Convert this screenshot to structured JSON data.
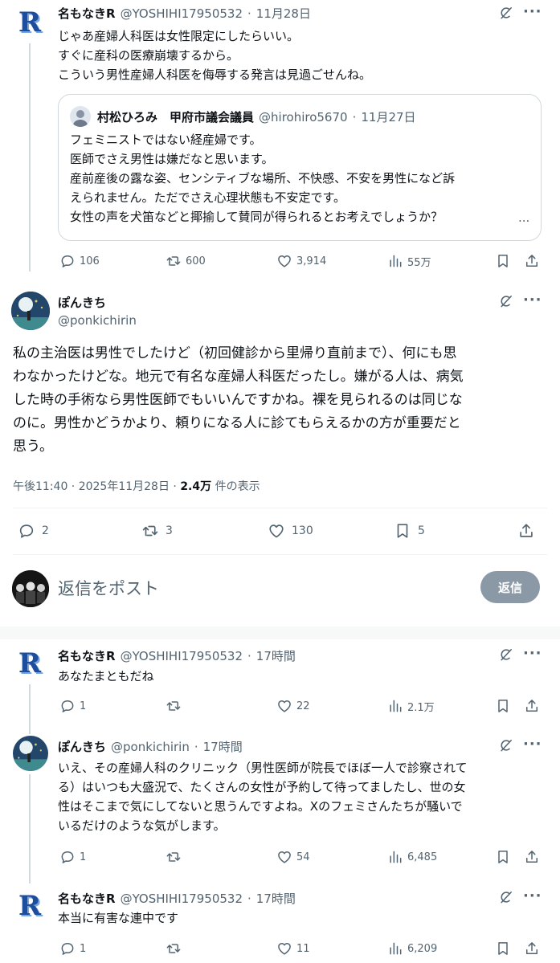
{
  "post1": {
    "name": "名もなきR",
    "handle": "@YOSHIHI17950532",
    "date": "11月28日",
    "lines": [
      "じゃあ産婦人科医は女性限定にしたらいい。",
      "すぐに産科の医療崩壊するから。",
      "こういう男性産婦人科医を侮辱する発言は見過ごせんね。"
    ],
    "quote": {
      "name": "村松ひろみ　甲府市議会議員",
      "handle": "@hirohiro5670",
      "date": "11月27日",
      "lines": [
        "フェミニストではない経産婦です。",
        "医師でさえ男性は嫌だなと思います。",
        "産前産後の露な姿、センシティブな場所、不快感、不安を男性になど訴",
        "えられません。ただでさえ心理状態も不安定です。",
        "女性の声を犬笛などと揶揄して賛同が得られるとお考えでしょうか？"
      ],
      "ellipsis": "..."
    },
    "replies": "106",
    "reposts": "600",
    "likes": "3,914",
    "views": "55万"
  },
  "main": {
    "name": "ぽんきち",
    "handle": "@ponkichirin",
    "lines": [
      "私の主治医は男性でしたけど（初回健診から里帰り直前まで）、何にも思",
      "わなかったけどな。地元で有名な産婦人科医だったし。嫌がる人は、病気",
      "した時の手術なら男性医師でもいいんですかね。裸を見られるのは同じな",
      "のに。男性かどうかより、頼りになる人に診てもらえるかの方が重要だと",
      "思う。"
    ],
    "timestamp": "午後11:40 · 2025年11月28日 · ",
    "views_count": "2.4万",
    "views_label": " 件の表示",
    "replies": "2",
    "reposts": "3",
    "likes": "130",
    "bookmarks": "5"
  },
  "composer": {
    "placeholder": "返信をポスト",
    "button": "返信"
  },
  "reply1": {
    "name": "名もなきR",
    "handle": "@YOSHIHI17950532",
    "time": "17時間",
    "lines": [
      "あなたまともだね"
    ],
    "replies": "1",
    "reposts": "",
    "likes": "22",
    "views": "2.1万"
  },
  "reply2": {
    "name": "ぽんきち",
    "handle": "@ponkichirin",
    "time": "17時間",
    "lines": [
      "いえ、その産婦人科のクリニック（男性医師が院長でほぼ一人で診察されて",
      "る）はいつも大盛況で、たくさんの女性が予約して待ってましたし、世の女",
      "性はそこまで気にしてないと思うんですよね。Xのフェミさんたちが騒いで",
      "いるだけのような気がします。"
    ],
    "replies": "1",
    "reposts": "",
    "likes": "54",
    "views": "6,485"
  },
  "reply3": {
    "name": "名もなきR",
    "handle": "@YOSHIHI17950532",
    "time": "17時間",
    "lines": [
      "本当に有害な連中です"
    ],
    "replies": "1",
    "reposts": "",
    "likes": "11",
    "views": "6,209"
  },
  "icons": {
    "reply": "reply-icon",
    "repost": "repost-icon",
    "like": "heart-icon",
    "views": "views-icon",
    "bookmark": "bookmark-icon",
    "share": "share-icon",
    "grok": "grok-icon",
    "more": "more-icon"
  },
  "colors": {
    "text": "#0f1419",
    "muted": "#536471",
    "border": "#cfd9de",
    "reply_button_bg": "#8b98a5",
    "logo_blue": "#1d4e9e"
  }
}
